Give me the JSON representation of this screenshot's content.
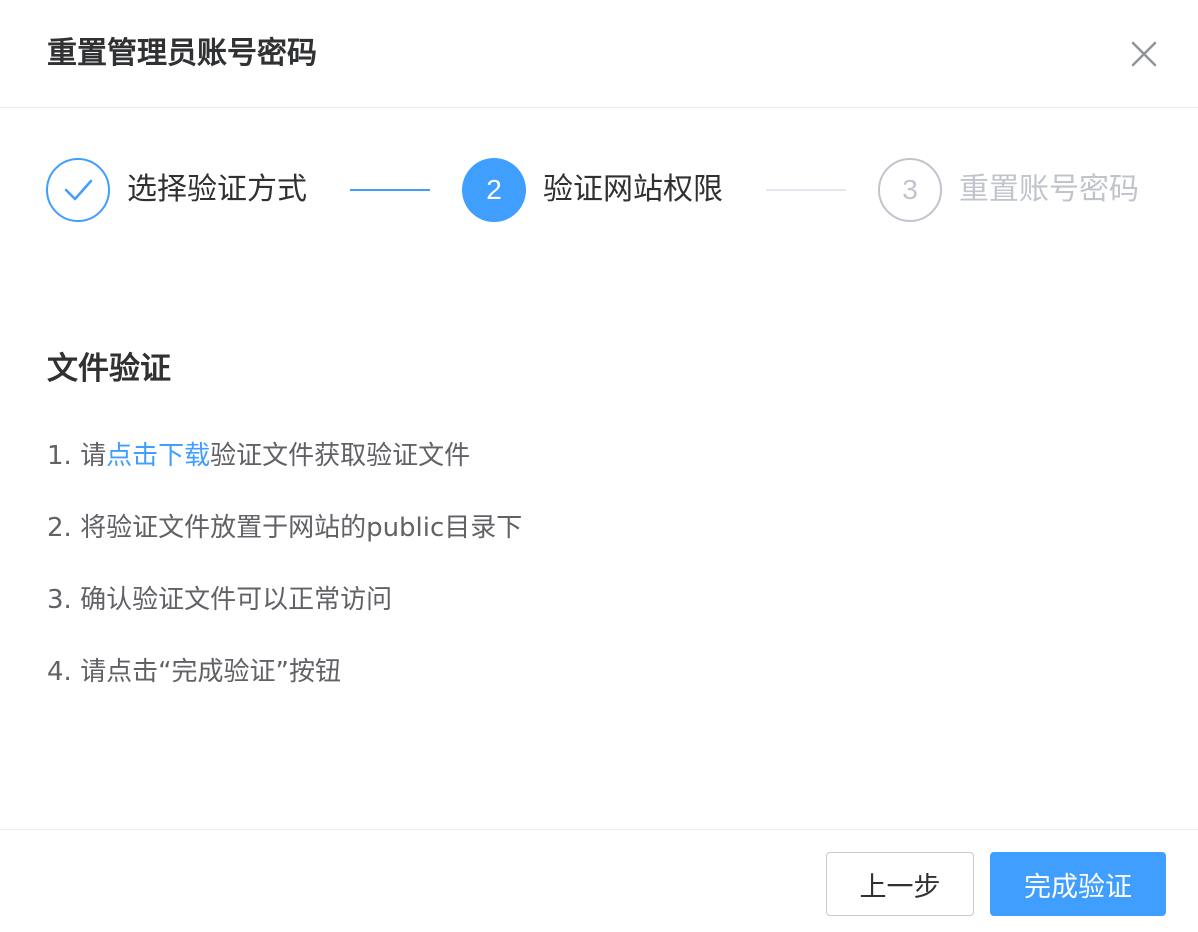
{
  "dialog": {
    "title": "重置管理员账号密码"
  },
  "steps": [
    {
      "number": "1",
      "label": "选择验证方式",
      "status": "done"
    },
    {
      "number": "2",
      "label": "验证网站权限",
      "status": "active"
    },
    {
      "number": "3",
      "label": "重置账号密码",
      "status": "wait"
    }
  ],
  "content": {
    "section_title": "文件验证",
    "instructions": [
      {
        "prefix": "1. 请",
        "link": "点击下载",
        "suffix": "验证文件获取验证文件"
      },
      {
        "text": "2. 将验证文件放置于网站的public目录下"
      },
      {
        "text": "3. 确认验证文件可以正常访问"
      },
      {
        "text": "4. 请点击“完成验证”按钮"
      }
    ]
  },
  "footer": {
    "prev_label": "上一步",
    "finish_label": "完成验证"
  },
  "colors": {
    "primary": "#409eff",
    "wait": "#c0c4cc",
    "text": "#303133",
    "secondary_text": "#606266"
  },
  "icons": {
    "close": "close-icon",
    "step_done": "check-icon"
  }
}
